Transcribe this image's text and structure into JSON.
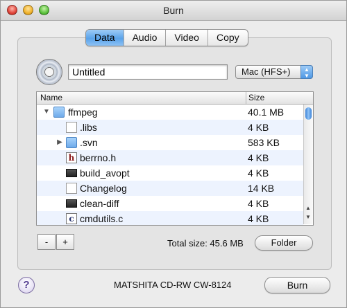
{
  "window": {
    "title": "Burn"
  },
  "tabs": [
    {
      "label": "Data",
      "active": true
    },
    {
      "label": "Audio",
      "active": false
    },
    {
      "label": "Video",
      "active": false
    },
    {
      "label": "Copy",
      "active": false
    }
  ],
  "disc": {
    "name": "Untitled",
    "format": "Mac (HFS+)"
  },
  "list": {
    "columns": {
      "name": "Name",
      "size": "Size"
    },
    "rows": [
      {
        "name": "ffmpeg",
        "size": "40.1 MB",
        "icon": "folder-icon",
        "disclosure": "expanded"
      },
      {
        "name": ".libs",
        "size": "4 KB",
        "icon": "document-icon",
        "disclosure": "none"
      },
      {
        "name": ".svn",
        "size": "583 KB",
        "icon": "folder-icon",
        "disclosure": "collapsed"
      },
      {
        "name": "berrno.h",
        "size": "4 KB",
        "icon": "header-file-icon",
        "disclosure": "none"
      },
      {
        "name": "build_avopt",
        "size": "4 KB",
        "icon": "executable-icon",
        "disclosure": "none"
      },
      {
        "name": "Changelog",
        "size": "14 KB",
        "icon": "document-icon",
        "disclosure": "none"
      },
      {
        "name": "clean-diff",
        "size": "4 KB",
        "icon": "executable-icon",
        "disclosure": "none"
      },
      {
        "name": "cmdutils.c",
        "size": "4 KB",
        "icon": "c-source-file-icon",
        "disclosure": "none"
      }
    ]
  },
  "footer": {
    "remove_label": "-",
    "add_label": "+",
    "total_size": "Total size: 45.6 MB",
    "folder_button": "Folder",
    "help_label": "?",
    "drive": "MATSHITA CD-RW CW-8124",
    "burn_button": "Burn"
  },
  "colors": {
    "accent": "#5aa3ea",
    "alt_row": "#edf3fe"
  }
}
